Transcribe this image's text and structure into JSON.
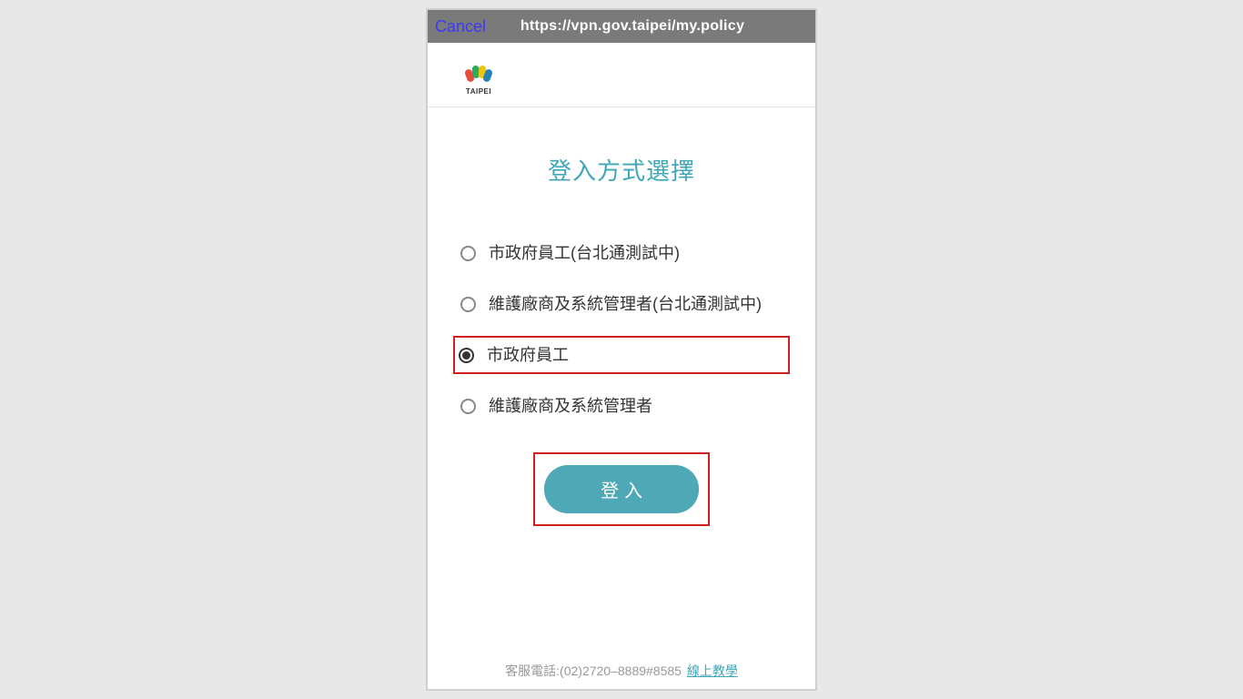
{
  "topbar": {
    "cancel_label": "Cancel",
    "url": "https://vpn.gov.taipei/my.policy"
  },
  "logo": {
    "name": "TAIPEI"
  },
  "main": {
    "title": "登入方式選擇",
    "options": [
      {
        "label": "市政府員工(台北通測試中)",
        "selected": false,
        "highlighted": false
      },
      {
        "label": "維護廠商及系統管理者(台北通測試中)",
        "selected": false,
        "highlighted": false
      },
      {
        "label": "市政府員工",
        "selected": true,
        "highlighted": true
      },
      {
        "label": "維護廠商及系統管理者",
        "selected": false,
        "highlighted": false
      }
    ],
    "login_button": "登入"
  },
  "footer": {
    "support_text": "客服電話:(02)2720–8889#8585",
    "link_label": "線上教學"
  },
  "colors": {
    "topbar_bg": "#7a7a7a",
    "cancel_color": "#3a3af5",
    "accent": "#3fa7b8",
    "button_bg": "#4ea8b5",
    "highlight_border": "#d02020"
  }
}
